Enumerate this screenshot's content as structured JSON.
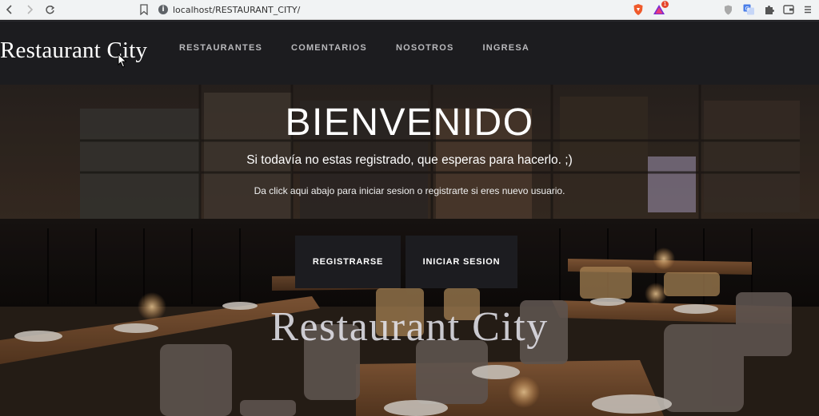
{
  "browser": {
    "url": "localhost/RESTAURANT_CITY/",
    "badge_count": "1"
  },
  "site": {
    "brand": "Restaurant City",
    "nav": [
      "RESTAURANTES",
      "COMENTARIOS",
      "NOSOTROS",
      "INGRESA"
    ]
  },
  "hero": {
    "title": "BIENVENIDO",
    "subtitle": "Si todavía no estas registrado, que esperas para hacerlo. ;)",
    "instructions": "Da click aqui abajo para iniciar sesion o registrarte si eres nuevo usuario.",
    "register_label": "REGISTRARSE",
    "login_label": "INICIAR SESION",
    "watermark": "Restaurant City"
  },
  "colors": {
    "header_bg": "#1c1c1f",
    "button_bg": "#1c1c20",
    "nav_text": "#b9b9bc"
  }
}
